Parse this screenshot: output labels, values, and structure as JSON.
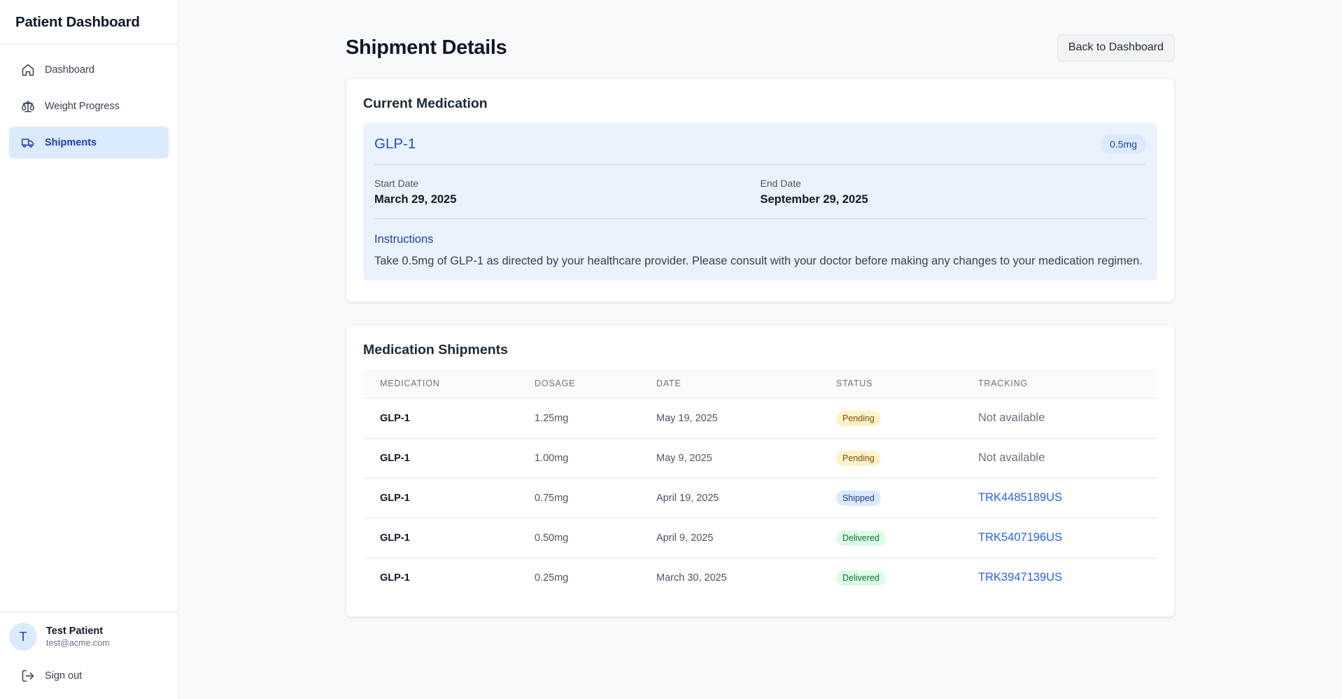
{
  "app": {
    "title": "Patient Dashboard"
  },
  "sidebar": {
    "items": [
      {
        "label": "Dashboard",
        "icon": "home-icon",
        "active": false
      },
      {
        "label": "Weight Progress",
        "icon": "scale-icon",
        "active": false
      },
      {
        "label": "Shipments",
        "icon": "truck-icon",
        "active": true
      }
    ],
    "user": {
      "initial": "T",
      "name": "Test Patient",
      "email": "test@acme.com"
    },
    "signout_label": "Sign out"
  },
  "page": {
    "title": "Shipment Details",
    "back_label": "Back to Dashboard"
  },
  "current_medication": {
    "section_title": "Current Medication",
    "name": "GLP-1",
    "dose": "0.5mg",
    "start_label": "Start Date",
    "start_value": "March 29, 2025",
    "end_label": "End Date",
    "end_value": "September 29, 2025",
    "instructions_label": "Instructions",
    "instructions_text": "Take 0.5mg of GLP-1 as directed by your healthcare provider. Please consult with your doctor before making any changes to your medication regimen."
  },
  "shipments": {
    "section_title": "Medication Shipments",
    "columns": [
      "MEDICATION",
      "DOSAGE",
      "DATE",
      "STATUS",
      "TRACKING"
    ],
    "rows": [
      {
        "medication": "GLP-1",
        "dosage": "1.25mg",
        "date": "May 19, 2025",
        "status": "Pending",
        "tracking": "Not available",
        "tracking_available": false
      },
      {
        "medication": "GLP-1",
        "dosage": "1.00mg",
        "date": "May 9, 2025",
        "status": "Pending",
        "tracking": "Not available",
        "tracking_available": false
      },
      {
        "medication": "GLP-1",
        "dosage": "0.75mg",
        "date": "April 19, 2025",
        "status": "Shipped",
        "tracking": "TRK4485189US",
        "tracking_available": true
      },
      {
        "medication": "GLP-1",
        "dosage": "0.50mg",
        "date": "April 9, 2025",
        "status": "Delivered",
        "tracking": "TRK5407196US",
        "tracking_available": true
      },
      {
        "medication": "GLP-1",
        "dosage": "0.25mg",
        "date": "March 30, 2025",
        "status": "Delivered",
        "tracking": "TRK3947139US",
        "tracking_available": true
      }
    ]
  },
  "colors": {
    "accent": "#1d4ed8",
    "active_nav_bg": "#dbeafe",
    "pending_bg": "#fef3c7",
    "shipped_bg": "#dbeafe",
    "delivered_bg": "#dcfce7"
  }
}
